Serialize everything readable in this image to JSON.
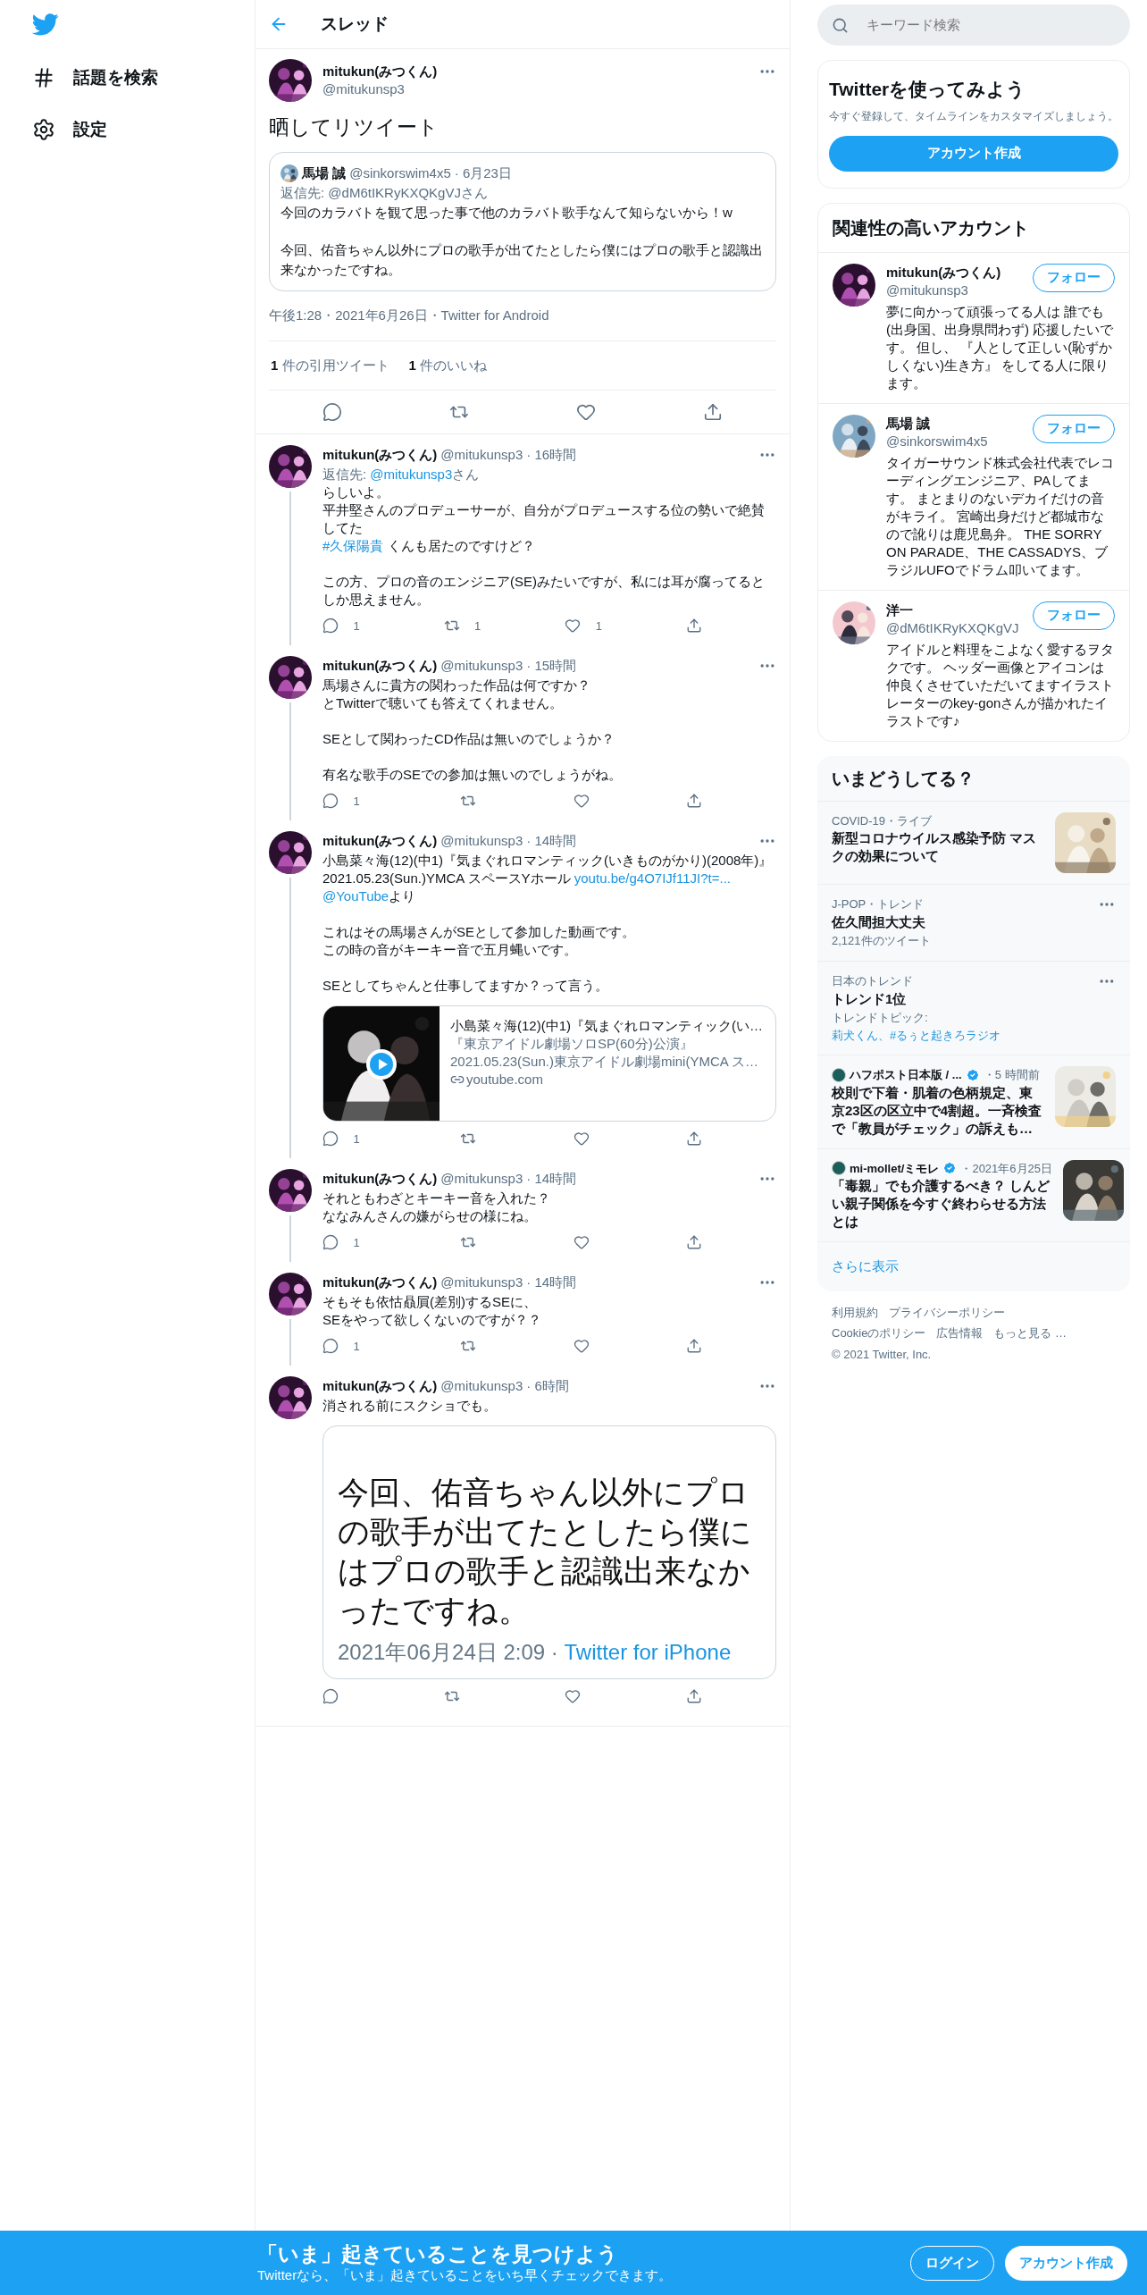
{
  "nav": [
    {
      "kind": "explore",
      "label": "話題を検索"
    },
    {
      "kind": "settings",
      "label": "設定"
    }
  ],
  "header": {
    "title": "スレッド"
  },
  "main_tweet": {
    "name": "mitukun(みつくん)",
    "handle": "@mitukunsp3",
    "text": "晒してリツイート",
    "quote": {
      "name": "馬場 誠",
      "handle": "@sinkorswim4x5",
      "date": "· 6月23日",
      "reply_to": "返信先: @dM6tIKRyKXQKgVJさん",
      "paragraphs": [
        "今回のカラバトを観て思った事で他のカラバト歌手なんて知らないから！w",
        "今回、佑音ちゃん以外にプロの歌手が出てたとしたら僕にはプロの歌手と認識出来なかったですね。"
      ]
    },
    "meta": "午後1:28・2021年6月26日・Twitter for Android",
    "stats": [
      {
        "count": "1",
        "label": " 件の引用ツイート"
      },
      {
        "count": "1",
        "label": " 件のいいね"
      }
    ],
    "actions": [
      {
        "kind": "reply"
      },
      {
        "kind": "retweet"
      },
      {
        "kind": "like"
      },
      {
        "kind": "share"
      }
    ]
  },
  "replies": [
    {
      "name": "mitukun(みつくん)",
      "handle": "@mitukunsp3",
      "time": "· 16時間",
      "reply_to": {
        "prefix": "返信先: ",
        "handle": "@mitukunsp3",
        "suffix": "さん"
      },
      "paragraphs": [
        [
          [
            {
              "text": "らしいよ。",
              "link": false
            }
          ],
          [
            {
              "text": "平井堅さんのプロデューサーが、自分がプロデュースする位の勢いで絶賛してた",
              "link": false
            }
          ],
          [
            {
              "text": "#久保陽貴",
              "link": true
            },
            {
              "text": " くんも居たのですけど？",
              "link": false
            }
          ]
        ],
        [
          [
            {
              "text": "この方、プロの音のエンジニア(SE)みたいですが、私には耳が腐ってるとしか思えません。",
              "link": false
            }
          ]
        ]
      ],
      "actions": [
        {
          "kind": "reply",
          "count": "1"
        },
        {
          "kind": "retweet",
          "count": "1"
        },
        {
          "kind": "like",
          "count": "1"
        },
        {
          "kind": "share"
        }
      ]
    },
    {
      "name": "mitukun(みつくん)",
      "handle": "@mitukunsp3",
      "time": "· 15時間",
      "paragraphs": [
        [
          [
            {
              "text": "馬場さんに貴方の関わった作品は何ですか？",
              "link": false
            }
          ],
          [
            {
              "text": "とTwitterで聴いても答えてくれません。",
              "link": false
            }
          ]
        ],
        [
          [
            {
              "text": "SEとして関わったCD作品は無いのでしょうか？",
              "link": false
            }
          ]
        ],
        [
          [
            {
              "text": "有名な歌手のSEでの参加は無いのでしょうがね。",
              "link": false
            }
          ]
        ]
      ],
      "actions": [
        {
          "kind": "reply",
          "count": "1"
        },
        {
          "kind": "retweet"
        },
        {
          "kind": "like"
        },
        {
          "kind": "share"
        }
      ]
    },
    {
      "name": "mitukun(みつくん)",
      "handle": "@mitukunsp3",
      "time": "· 14時間",
      "paragraphs": [
        [
          [
            {
              "text": "小島菜々海(12)(中1)『気まぐれロマンティック(いきものがかり)(2008年)』",
              "link": false
            }
          ],
          [
            {
              "text": "2021.05.23(Sun.)YMCA スペースYホール ",
              "link": false
            },
            {
              "text": "youtu.be/g4O7IJf11JI?t=...",
              "link": true
            }
          ],
          [
            {
              "text": "@YouTube",
              "link": true
            },
            {
              "text": "より",
              "link": false
            }
          ]
        ],
        [
          [
            {
              "text": "これはその馬場さんがSEとして参加した動画です。",
              "link": false
            }
          ],
          [
            {
              "text": "この時の音がキーキー音で五月蝿いです。",
              "link": false
            }
          ]
        ],
        [
          [
            {
              "text": "SEとしてちゃんと仕事してますか？って言う。",
              "link": false
            }
          ]
        ]
      ],
      "card": {
        "title": "小島菜々海(12)(中1)『気まぐれロマンティック(い…",
        "subtitle": "『東京アイドル劇場ソロSP(60分)公演』",
        "description": "2021.05.23(Sun.)東京アイドル劇場mini(YMCA ス…",
        "domain": "youtube.com"
      },
      "actions": [
        {
          "kind": "reply",
          "count": "1"
        },
        {
          "kind": "retweet"
        },
        {
          "kind": "like"
        },
        {
          "kind": "share"
        }
      ]
    },
    {
      "name": "mitukun(みつくん)",
      "handle": "@mitukunsp3",
      "time": "· 14時間",
      "paragraphs": [
        [
          [
            {
              "text": "それともわざとキーキー音を入れた？",
              "link": false
            }
          ],
          [
            {
              "text": "ななみんさんの嫌がらせの様にね。",
              "link": false
            }
          ]
        ]
      ],
      "actions": [
        {
          "kind": "reply",
          "count": "1"
        },
        {
          "kind": "retweet"
        },
        {
          "kind": "like"
        },
        {
          "kind": "share"
        }
      ]
    },
    {
      "name": "mitukun(みつくん)",
      "handle": "@mitukunsp3",
      "time": "· 14時間",
      "paragraphs": [
        [
          [
            {
              "text": "そもそも依怙贔屓(差別)するSEに、",
              "link": false
            }
          ],
          [
            {
              "text": "SEをやって欲しくないのですが？？",
              "link": false
            }
          ]
        ]
      ],
      "actions": [
        {
          "kind": "reply",
          "count": "1"
        },
        {
          "kind": "retweet"
        },
        {
          "kind": "like"
        },
        {
          "kind": "share"
        }
      ]
    },
    {
      "name": "mitukun(みつくん)",
      "handle": "@mitukunsp3",
      "time": "· 6時間",
      "paragraphs": [
        [
          [
            {
              "text": "消される前にスクショでも。",
              "link": false
            }
          ]
        ]
      ],
      "screenshot": {
        "text": "今回、佑音ちゃん以外にプロの歌手が出てたとしたら僕にはプロの歌手と認識出来なかったですね。",
        "date": "2021年06月24日 2:09 · ",
        "source": "Twitter for iPhone"
      },
      "actions": [
        {
          "kind": "reply"
        },
        {
          "kind": "retweet"
        },
        {
          "kind": "like"
        },
        {
          "kind": "share"
        }
      ]
    }
  ],
  "search": {
    "placeholder": "キーワード検索"
  },
  "signup": {
    "title": "Twitterを使ってみよう",
    "text": "今すぐ登録して、タイムラインをカスタマイズしましょう。",
    "button": "アカウント作成"
  },
  "who_to_follow": {
    "title": "関連性の高いアカウント",
    "accounts": [
      {
        "name": "mitukun(みつくん)",
        "handle": "@mitukunsp3",
        "bio": "夢に向かって頑張ってる人は 誰でも(出身国、出身県問わず) 応援したいです。 但し、 『人として正しい(恥ずかしくない)生き方』 をしてる人に限ります。",
        "button": "フォロー"
      },
      {
        "name": "馬場 誠",
        "handle": "@sinkorswim4x5",
        "bio": "タイガーサウンド株式会社代表でレコーディングエンジニア、PAしてます。 まとまりのないデカイだけの音がキライ。 宮崎出身だけど都城市なので訛りは鹿児島弁。 THE SORRY ON PARADE、THE CASSADYS、ブラジルUFOでドラム叩いてます。",
        "button": "フォロー"
      },
      {
        "name": "洋一",
        "handle": "@dM6tIKRyKXQKgVJ",
        "bio": "アイドルと料理をこよなく愛するヲタクです。 ヘッダー画像とアイコンは仲良くさせていただいてますイラストレーターのkey-gonさんが描かれたイラストです♪",
        "button": "フォロー"
      }
    ]
  },
  "trends": {
    "title": "いまどうしてる？",
    "items": [
      {
        "kind": "topic",
        "context": "COVID-19・ライブ",
        "title": "新型コロナウイルス感染予防 マスクの効果について"
      },
      {
        "kind": "trend",
        "context": "J-POP・トレンド",
        "title": "佐久間担大丈夫",
        "sub": "2,121件のツイート"
      },
      {
        "kind": "trend",
        "context": "日本のトレンド",
        "title": "トレンド1位",
        "sub_prefix": "トレンドトピック: ",
        "sub_link": "莉犬くん、#るぅと起きろラジオ"
      },
      {
        "kind": "news",
        "source": "ハフポスト日本版 / ...",
        "verified": true,
        "time": "・5 時間前",
        "title": "校則で下着・肌着の色柄規定、東京23区の区立中で4割超。一斉検査で「教員がチェック」の訴えも…"
      },
      {
        "kind": "news",
        "source": "mi-mollet/ミモレ",
        "verified": true,
        "time": "・2021年6月25日",
        "title": "「毒親」でも介護するべき？ しんどい親子関係を今すぐ終わらせる方法とは"
      }
    ],
    "more": "さらに表示"
  },
  "footer": {
    "links": [
      "利用規約",
      "プライバシーポリシー",
      "Cookieのポリシー",
      "広告情報",
      "もっと見る …"
    ],
    "copyright": "© 2021 Twitter, Inc."
  },
  "bottom_bar": {
    "title": "「いま」起きていることを見つけよう",
    "subtitle": "Twitterなら、「いま」起きていることをいち早くチェックできます。",
    "login": "ログイン",
    "signup": "アカウント作成"
  }
}
